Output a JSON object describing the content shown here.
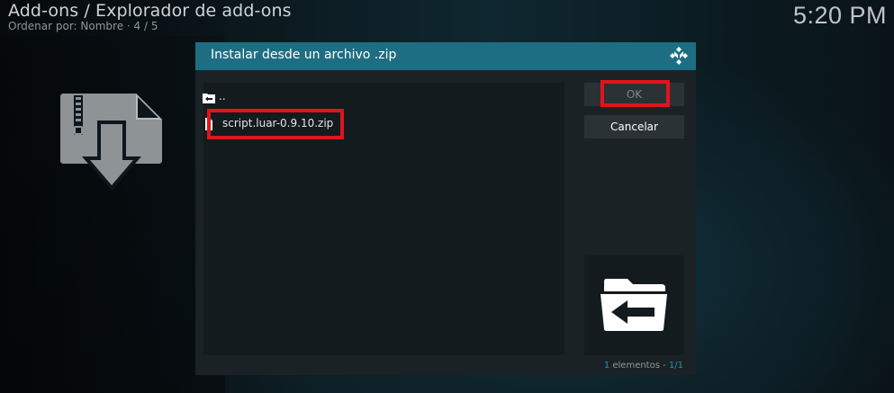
{
  "header": {
    "title": "Add-ons / Explorador de add-ons",
    "subtitle": "Ordenar por: Nombre  ·  4 / 5"
  },
  "clock": "5:20 PM",
  "dialog": {
    "title": "Instalar desde un archivo .zip",
    "files": [
      {
        "label": "..",
        "icon": "parent-folder-icon"
      },
      {
        "label": "script.luar-0.9.10.zip",
        "icon": "file-icon"
      }
    ],
    "ok_label": "OK",
    "cancel_label": "Cancelar",
    "count_number": "1",
    "count_text": " elementos - ",
    "count_page": "1/1"
  },
  "colors": {
    "header_bar": "#1d6e82",
    "dialog_bg": "#1b2225",
    "highlight": "#e0141c",
    "accent": "#2b8fb0"
  }
}
